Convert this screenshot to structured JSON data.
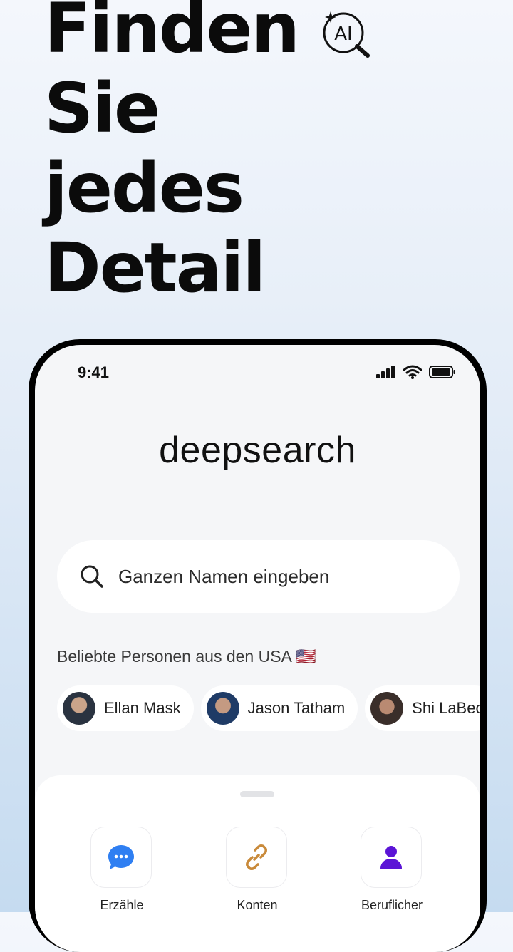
{
  "headline": {
    "lines": [
      "Finden",
      "Sie",
      "jedes",
      "Detail"
    ],
    "badge": "AI"
  },
  "status_bar": {
    "time": "9:41"
  },
  "app": {
    "title": "deepsearch"
  },
  "search": {
    "placeholder": "Ganzen Namen eingeben"
  },
  "popular": {
    "label": "Beliebte Personen aus den USA 🇺🇸",
    "people": [
      {
        "name": "Ellan Mask"
      },
      {
        "name": "Jason Tatham"
      },
      {
        "name": "Shi LaBeo"
      }
    ]
  },
  "actions": [
    {
      "label": "Erzähle",
      "icon": "chat-bubble-icon",
      "color": "#2f7ff2"
    },
    {
      "label": "Konten",
      "icon": "link-icon",
      "color": "#c98a3a"
    },
    {
      "label": "Beruflicher",
      "icon": "person-icon",
      "color": "#5b14d6"
    }
  ]
}
